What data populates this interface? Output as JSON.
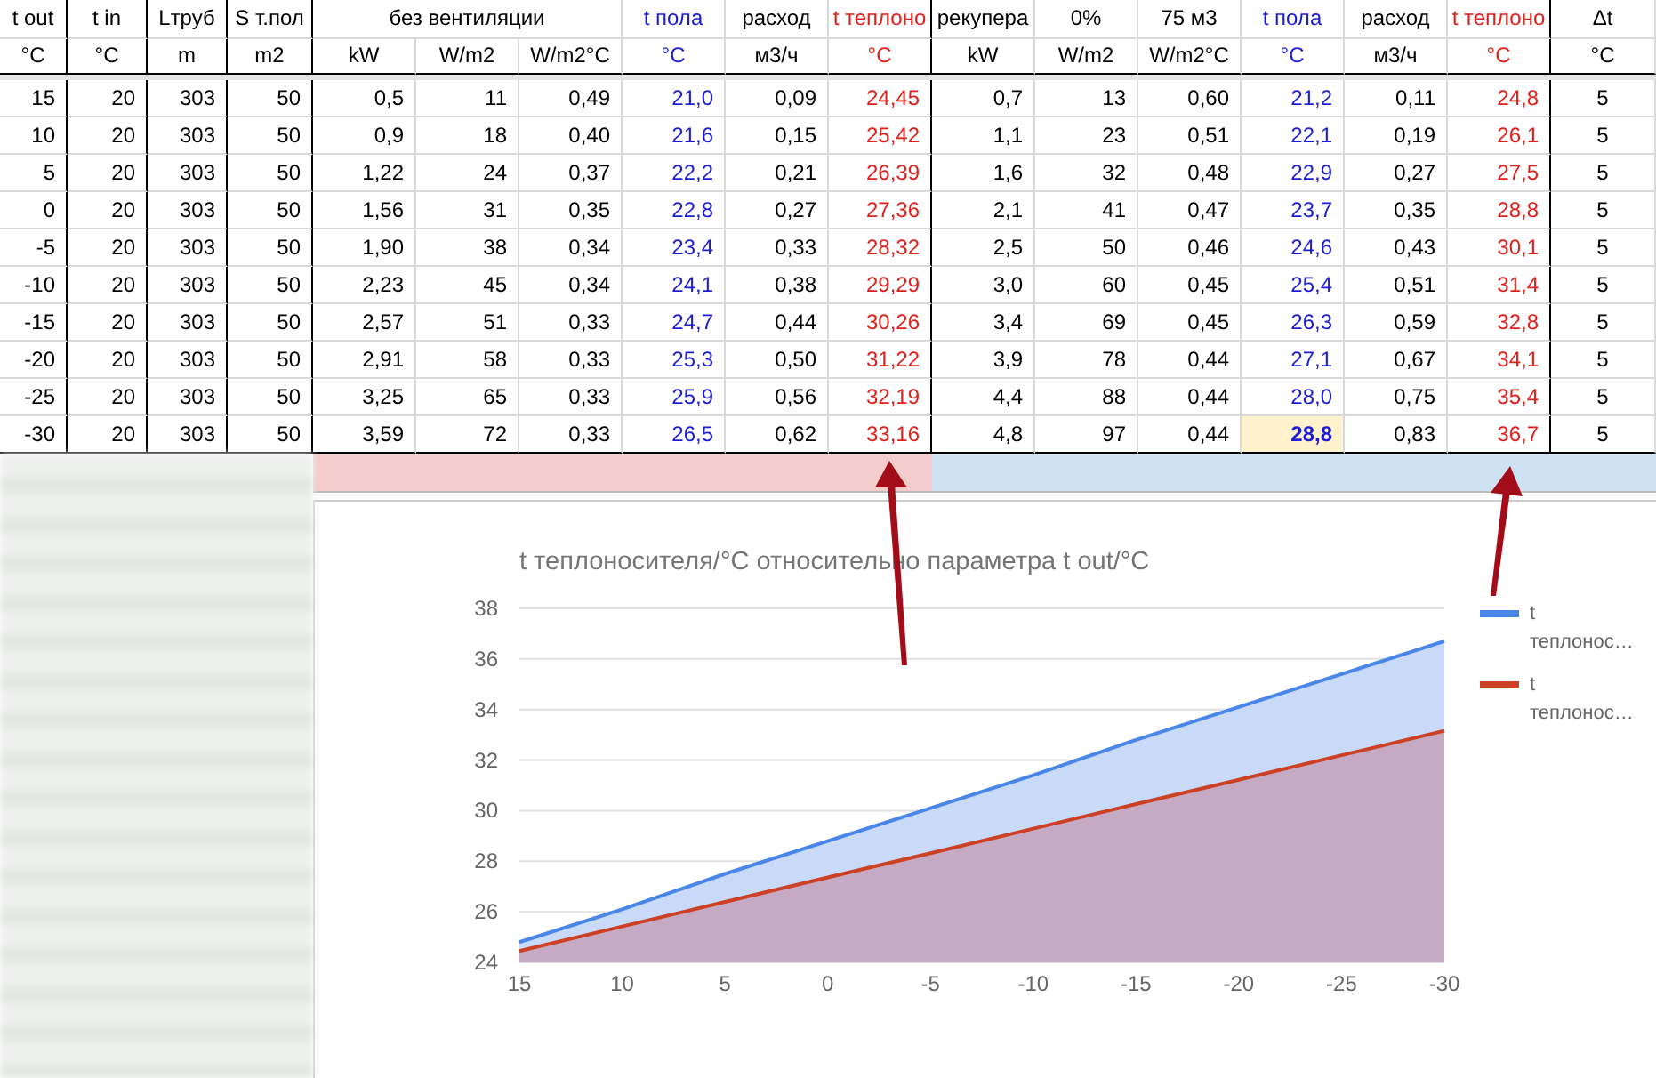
{
  "table": {
    "headers": [
      {
        "title": "t out",
        "units": [
          "°C"
        ],
        "color": "#000000"
      },
      {
        "title": "t in",
        "units": [
          "°C"
        ],
        "color": "#000000"
      },
      {
        "title": "Lтруб",
        "units": [
          "m"
        ],
        "color": "#000000"
      },
      {
        "title": "S т.пол",
        "units": [
          "m2"
        ],
        "color": "#000000"
      },
      {
        "title": "без вентиляции",
        "units": [
          "kW",
          "W/m2",
          "W/m2°C"
        ],
        "color": "#000000"
      },
      {
        "title": "t пола",
        "units": [
          "°C"
        ],
        "color": "#1c1cd6"
      },
      {
        "title": "расход",
        "units": [
          "м3/ч"
        ],
        "color": "#000000"
      },
      {
        "title": "t теплоно",
        "units": [
          "°C"
        ],
        "color": "#e0201c"
      },
      {
        "title": "рекупера",
        "units": [
          "kW"
        ],
        "color": "#000000"
      },
      {
        "title": "0%",
        "units": [
          "W/m2"
        ],
        "color": "#000000"
      },
      {
        "title": "75 м3",
        "units": [
          "W/m2°C"
        ],
        "color": "#000000"
      },
      {
        "title": "t пола",
        "units": [
          "°C"
        ],
        "color": "#1c1cd6"
      },
      {
        "title": "расход",
        "units": [
          "м3/ч"
        ],
        "color": "#000000"
      },
      {
        "title": "t теплоно",
        "units": [
          "°C"
        ],
        "color": "#e0201c"
      },
      {
        "title": "Δt",
        "units": [
          "°C"
        ],
        "color": "#000000"
      }
    ],
    "rows": [
      {
        "cells": [
          {
            "text": "15",
            "selected": false
          },
          {
            "text": "20",
            "selected": false
          },
          {
            "text": "303",
            "selected": false
          },
          {
            "text": "50",
            "selected": false
          },
          {
            "text": "0,5",
            "selected": false
          },
          {
            "text": "11",
            "selected": false
          },
          {
            "text": "0,49",
            "selected": false
          },
          {
            "text": "21,0",
            "selected": false
          },
          {
            "text": "0,09",
            "selected": false
          },
          {
            "text": "24,45",
            "selected": false
          },
          {
            "text": "0,7",
            "selected": false
          },
          {
            "text": "13",
            "selected": false
          },
          {
            "text": "0,60",
            "selected": false
          },
          {
            "text": "21,2",
            "selected": false
          },
          {
            "text": "0,11",
            "selected": false
          },
          {
            "text": "24,8",
            "selected": false
          },
          {
            "text": "5",
            "selected": false
          }
        ]
      },
      {
        "cells": [
          {
            "text": "10",
            "selected": false
          },
          {
            "text": "20",
            "selected": false
          },
          {
            "text": "303",
            "selected": false
          },
          {
            "text": "50",
            "selected": false
          },
          {
            "text": "0,9",
            "selected": false
          },
          {
            "text": "18",
            "selected": false
          },
          {
            "text": "0,40",
            "selected": false
          },
          {
            "text": "21,6",
            "selected": false
          },
          {
            "text": "0,15",
            "selected": false
          },
          {
            "text": "25,42",
            "selected": false
          },
          {
            "text": "1,1",
            "selected": false
          },
          {
            "text": "23",
            "selected": false
          },
          {
            "text": "0,51",
            "selected": false
          },
          {
            "text": "22,1",
            "selected": false
          },
          {
            "text": "0,19",
            "selected": false
          },
          {
            "text": "26,1",
            "selected": false
          },
          {
            "text": "5",
            "selected": false
          }
        ]
      },
      {
        "cells": [
          {
            "text": "5",
            "selected": false
          },
          {
            "text": "20",
            "selected": false
          },
          {
            "text": "303",
            "selected": false
          },
          {
            "text": "50",
            "selected": false
          },
          {
            "text": "1,22",
            "selected": false
          },
          {
            "text": "24",
            "selected": false
          },
          {
            "text": "0,37",
            "selected": false
          },
          {
            "text": "22,2",
            "selected": false
          },
          {
            "text": "0,21",
            "selected": false
          },
          {
            "text": "26,39",
            "selected": false
          },
          {
            "text": "1,6",
            "selected": false
          },
          {
            "text": "32",
            "selected": false
          },
          {
            "text": "0,48",
            "selected": false
          },
          {
            "text": "22,9",
            "selected": false
          },
          {
            "text": "0,27",
            "selected": false
          },
          {
            "text": "27,5",
            "selected": false
          },
          {
            "text": "5",
            "selected": false
          }
        ]
      },
      {
        "cells": [
          {
            "text": "0",
            "selected": false
          },
          {
            "text": "20",
            "selected": false
          },
          {
            "text": "303",
            "selected": false
          },
          {
            "text": "50",
            "selected": false
          },
          {
            "text": "1,56",
            "selected": false
          },
          {
            "text": "31",
            "selected": false
          },
          {
            "text": "0,35",
            "selected": false
          },
          {
            "text": "22,8",
            "selected": false
          },
          {
            "text": "0,27",
            "selected": false
          },
          {
            "text": "27,36",
            "selected": false
          },
          {
            "text": "2,1",
            "selected": false
          },
          {
            "text": "41",
            "selected": false
          },
          {
            "text": "0,47",
            "selected": false
          },
          {
            "text": "23,7",
            "selected": false
          },
          {
            "text": "0,35",
            "selected": false
          },
          {
            "text": "28,8",
            "selected": false
          },
          {
            "text": "5",
            "selected": false
          }
        ]
      },
      {
        "cells": [
          {
            "text": "-5",
            "selected": false
          },
          {
            "text": "20",
            "selected": false
          },
          {
            "text": "303",
            "selected": false
          },
          {
            "text": "50",
            "selected": false
          },
          {
            "text": "1,90",
            "selected": false
          },
          {
            "text": "38",
            "selected": false
          },
          {
            "text": "0,34",
            "selected": false
          },
          {
            "text": "23,4",
            "selected": false
          },
          {
            "text": "0,33",
            "selected": false
          },
          {
            "text": "28,32",
            "selected": false
          },
          {
            "text": "2,5",
            "selected": false
          },
          {
            "text": "50",
            "selected": false
          },
          {
            "text": "0,46",
            "selected": false
          },
          {
            "text": "24,6",
            "selected": false
          },
          {
            "text": "0,43",
            "selected": false
          },
          {
            "text": "30,1",
            "selected": false
          },
          {
            "text": "5",
            "selected": false
          }
        ]
      },
      {
        "cells": [
          {
            "text": "-10",
            "selected": false
          },
          {
            "text": "20",
            "selected": false
          },
          {
            "text": "303",
            "selected": false
          },
          {
            "text": "50",
            "selected": false
          },
          {
            "text": "2,23",
            "selected": false
          },
          {
            "text": "45",
            "selected": false
          },
          {
            "text": "0,34",
            "selected": false
          },
          {
            "text": "24,1",
            "selected": false
          },
          {
            "text": "0,38",
            "selected": false
          },
          {
            "text": "29,29",
            "selected": false
          },
          {
            "text": "3,0",
            "selected": false
          },
          {
            "text": "60",
            "selected": false
          },
          {
            "text": "0,45",
            "selected": false
          },
          {
            "text": "25,4",
            "selected": false
          },
          {
            "text": "0,51",
            "selected": false
          },
          {
            "text": "31,4",
            "selected": false
          },
          {
            "text": "5",
            "selected": false
          }
        ]
      },
      {
        "cells": [
          {
            "text": "-15",
            "selected": false
          },
          {
            "text": "20",
            "selected": false
          },
          {
            "text": "303",
            "selected": false
          },
          {
            "text": "50",
            "selected": false
          },
          {
            "text": "2,57",
            "selected": false
          },
          {
            "text": "51",
            "selected": false
          },
          {
            "text": "0,33",
            "selected": false
          },
          {
            "text": "24,7",
            "selected": false
          },
          {
            "text": "0,44",
            "selected": false
          },
          {
            "text": "30,26",
            "selected": false
          },
          {
            "text": "3,4",
            "selected": false
          },
          {
            "text": "69",
            "selected": false
          },
          {
            "text": "0,45",
            "selected": false
          },
          {
            "text": "26,3",
            "selected": false
          },
          {
            "text": "0,59",
            "selected": false
          },
          {
            "text": "32,8",
            "selected": false
          },
          {
            "text": "5",
            "selected": false
          }
        ]
      },
      {
        "cells": [
          {
            "text": "-20",
            "selected": false
          },
          {
            "text": "20",
            "selected": false
          },
          {
            "text": "303",
            "selected": false
          },
          {
            "text": "50",
            "selected": false
          },
          {
            "text": "2,91",
            "selected": false
          },
          {
            "text": "58",
            "selected": false
          },
          {
            "text": "0,33",
            "selected": false
          },
          {
            "text": "25,3",
            "selected": false
          },
          {
            "text": "0,50",
            "selected": false
          },
          {
            "text": "31,22",
            "selected": false
          },
          {
            "text": "3,9",
            "selected": false
          },
          {
            "text": "78",
            "selected": false
          },
          {
            "text": "0,44",
            "selected": false
          },
          {
            "text": "27,1",
            "selected": false
          },
          {
            "text": "0,67",
            "selected": false
          },
          {
            "text": "34,1",
            "selected": false
          },
          {
            "text": "5",
            "selected": false
          }
        ]
      },
      {
        "cells": [
          {
            "text": "-25",
            "selected": false
          },
          {
            "text": "20",
            "selected": false
          },
          {
            "text": "303",
            "selected": false
          },
          {
            "text": "50",
            "selected": false
          },
          {
            "text": "3,25",
            "selected": false
          },
          {
            "text": "65",
            "selected": false
          },
          {
            "text": "0,33",
            "selected": false
          },
          {
            "text": "25,9",
            "selected": false
          },
          {
            "text": "0,56",
            "selected": false
          },
          {
            "text": "32,19",
            "selected": false
          },
          {
            "text": "4,4",
            "selected": false
          },
          {
            "text": "88",
            "selected": false
          },
          {
            "text": "0,44",
            "selected": false
          },
          {
            "text": "28,0",
            "selected": false
          },
          {
            "text": "0,75",
            "selected": false
          },
          {
            "text": "35,4",
            "selected": false
          },
          {
            "text": "5",
            "selected": false
          }
        ]
      },
      {
        "cells": [
          {
            "text": "-30",
            "selected": false
          },
          {
            "text": "20",
            "selected": false
          },
          {
            "text": "303",
            "selected": false
          },
          {
            "text": "50",
            "selected": false
          },
          {
            "text": "3,59",
            "selected": false
          },
          {
            "text": "72",
            "selected": false
          },
          {
            "text": "0,33",
            "selected": false
          },
          {
            "text": "26,5",
            "selected": false
          },
          {
            "text": "0,62",
            "selected": false
          },
          {
            "text": "33,16",
            "selected": false
          },
          {
            "text": "4,8",
            "selected": false
          },
          {
            "text": "97",
            "selected": false
          },
          {
            "text": "0,44",
            "selected": false
          },
          {
            "text": "28,8",
            "selected": true
          },
          {
            "text": "0,83",
            "selected": false
          },
          {
            "text": "36,7",
            "selected": false
          },
          {
            "text": "5",
            "selected": false
          }
        ]
      }
    ]
  },
  "chart": {
    "chart_data": {
      "type": "area",
      "title": "t теплоносителя/°C относительно параметра t out/°C",
      "categories": [
        "15",
        "10",
        "5",
        "0",
        "-5",
        "-10",
        "-15",
        "-20",
        "-25",
        "-30"
      ],
      "series": [
        {
          "name": "t теплонос…",
          "color": "#4a86e8",
          "values": [
            24.8,
            26.1,
            27.5,
            28.8,
            30.1,
            31.4,
            32.8,
            34.1,
            35.4,
            36.7
          ]
        },
        {
          "name": "t теплонос…",
          "color": "#cc4125",
          "values": [
            24.45,
            25.42,
            26.39,
            27.36,
            28.32,
            29.29,
            30.26,
            31.22,
            32.19,
            33.16
          ]
        }
      ],
      "grid": true,
      "ylim": [
        24,
        38
      ],
      "yticks": [
        24,
        26,
        28,
        30,
        32,
        34,
        36,
        38
      ]
    }
  }
}
